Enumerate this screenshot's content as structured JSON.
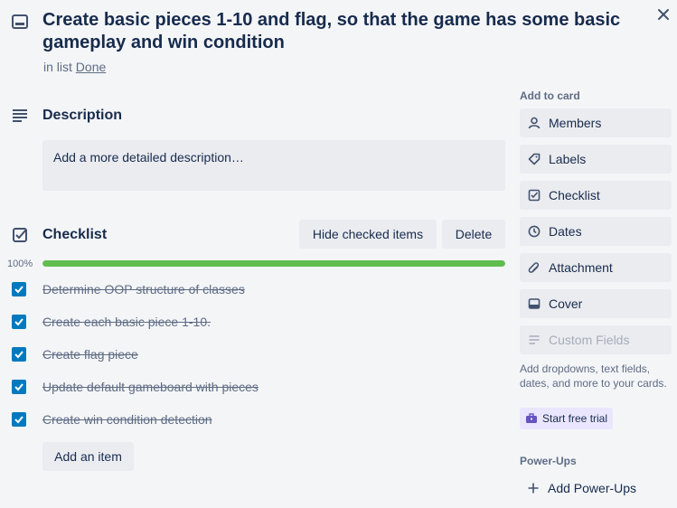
{
  "card": {
    "title": "Create basic pieces 1-10 and flag, so that the game has some basic gameplay and win condition",
    "in_list_prefix": "in list",
    "list_name": "Done"
  },
  "description": {
    "heading": "Description",
    "placeholder": "Add a more detailed description…"
  },
  "checklist": {
    "heading": "Checklist",
    "hide_checked_label": "Hide checked items",
    "delete_label": "Delete",
    "progress_label": "100%",
    "progress": 1.0,
    "items": [
      {
        "text": "Determine OOP structure of classes",
        "checked": true
      },
      {
        "text": "Create each basic piece 1-10.",
        "checked": true
      },
      {
        "text": "Create flag piece",
        "checked": true
      },
      {
        "text": "Update default gameboard with pieces",
        "checked": true
      },
      {
        "text": "Create win condition detection",
        "checked": true
      }
    ],
    "add_item_label": "Add an item"
  },
  "sidebar": {
    "add_to_card_label": "Add to card",
    "buttons": [
      {
        "label": "Members",
        "icon": "person-icon"
      },
      {
        "label": "Labels",
        "icon": "tag-icon"
      },
      {
        "label": "Checklist",
        "icon": "checkbox-icon"
      },
      {
        "label": "Dates",
        "icon": "clock-icon"
      },
      {
        "label": "Attachment",
        "icon": "paperclip-icon"
      },
      {
        "label": "Cover",
        "icon": "cover-icon"
      },
      {
        "label": "Custom Fields",
        "icon": "custom-fields-icon",
        "disabled": true
      }
    ],
    "upsell_text": "Add dropdowns, text fields, dates, and more to your cards.",
    "trial_label": "Start free trial",
    "powerups_label": "Power-Ups",
    "add_powerups_label": "Add Power-Ups"
  },
  "colors": {
    "accent_blue": "#0079bf",
    "progress_green": "#61bd4f",
    "text_dark": "#172b4d",
    "text_muted": "#5e6c84",
    "button_bg": "#ebecf0"
  }
}
